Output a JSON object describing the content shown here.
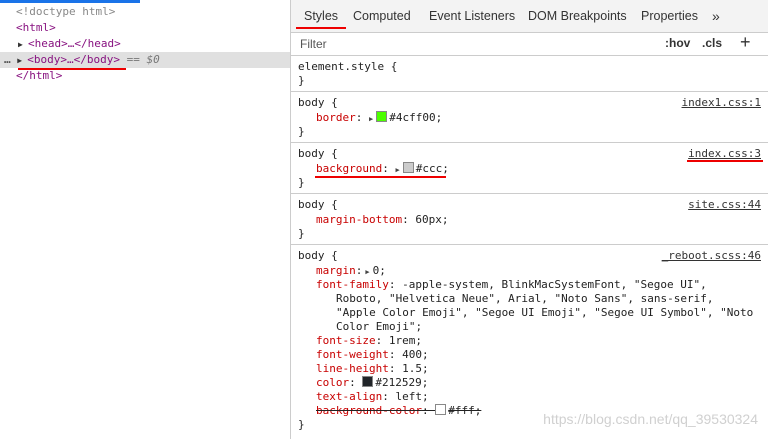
{
  "dom": {
    "doctype": "<!doctype html>",
    "html_open": "<html>",
    "head": "<head>…</head>",
    "body": "<body>…</body>",
    "selected_marker": "== $0",
    "html_close": "</html>"
  },
  "tabs": [
    "Styles",
    "Computed",
    "Event Listeners",
    "DOM Breakpoints",
    "Properties",
    "»"
  ],
  "filter": {
    "placeholder": "Filter",
    "hov": ":hov",
    "cls": ".cls",
    "add": "+"
  },
  "rules": {
    "element_style": {
      "selector": "element.style {",
      "close": "}"
    },
    "r1": {
      "selector": "body {",
      "source": "index1.css:1",
      "prop": "border",
      "value": "#4cff00;",
      "swatch": "#4cff00",
      "close": "}"
    },
    "r2": {
      "selector": "body {",
      "source": "index.css:3",
      "prop": "background",
      "value": "#ccc;",
      "swatch": "#cccccc",
      "close": "}"
    },
    "r3": {
      "selector": "body {",
      "source": "site.css:44",
      "prop": "margin-bottom",
      "value": "60px;",
      "close": "}"
    },
    "r4": {
      "selector": "body {",
      "source": "_reboot.scss:46",
      "margin": {
        "prop": "margin",
        "value": "0;"
      },
      "font_family": {
        "prop": "font-family",
        "l1": "-apple-system, BlinkMacSystemFont, \"Segoe UI\",",
        "l2": "Roboto, \"Helvetica Neue\", Arial, \"Noto Sans\", sans-serif,",
        "l3": "\"Apple Color Emoji\", \"Segoe UI Emoji\", \"Segoe UI Symbol\", \"Noto",
        "l4": "Color Emoji\";"
      },
      "font_size": {
        "prop": "font-size",
        "value": "1rem;"
      },
      "font_weight": {
        "prop": "font-weight",
        "value": "400;"
      },
      "line_height": {
        "prop": "line-height",
        "value": "1.5;"
      },
      "color": {
        "prop": "color",
        "value": "#212529;",
        "swatch": "#212529"
      },
      "text_align": {
        "prop": "text-align",
        "value": "left;"
      },
      "bg_color": {
        "prop": "background-color",
        "value": "#fff;",
        "swatch": "#ffffff"
      },
      "close": "}"
    }
  },
  "watermark": "https://blog.csdn.net/qq_39530324",
  "colors": {
    "annotation": "#e00000",
    "active_tab": "#1a73e8"
  }
}
